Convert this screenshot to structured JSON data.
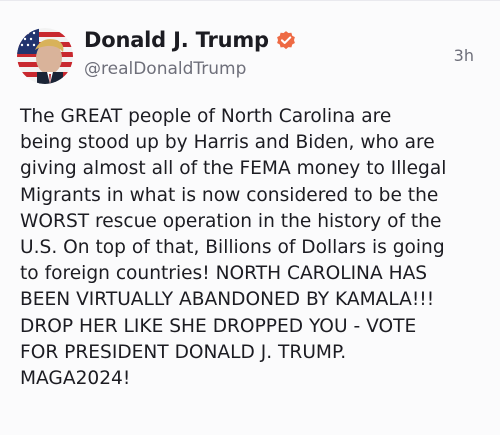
{
  "post": {
    "author_name": "Donald J. Trump",
    "handle": "@realDonaldTrump",
    "timestamp": "3h",
    "verified_icon": "verified-badge-icon",
    "avatar": "avatar-image",
    "body_lines": [
      "The GREAT people of North Carolina are",
      "being stood up by Harris and Biden, who are",
      "giving almost all of the FEMA money to Illegal",
      "Migrants in what is now considered to be the",
      "WORST rescue operation in the history of the",
      "U.S. On top of that, Billions of Dollars is going",
      "to foreign countries! NORTH CAROLINA HAS",
      "BEEN VIRTUALLY ABANDONED BY KAMALA!!!",
      "DROP HER LIKE SHE DROPPED YOU - VOTE",
      "FOR PRESIDENT DONALD J. TRUMP.",
      "MAGA2024!"
    ]
  },
  "colors": {
    "background": "#fbfbfc",
    "verified_badge": "#ee6a44",
    "text_primary": "#1c1c22",
    "text_secondary": "#6e6f7a"
  }
}
